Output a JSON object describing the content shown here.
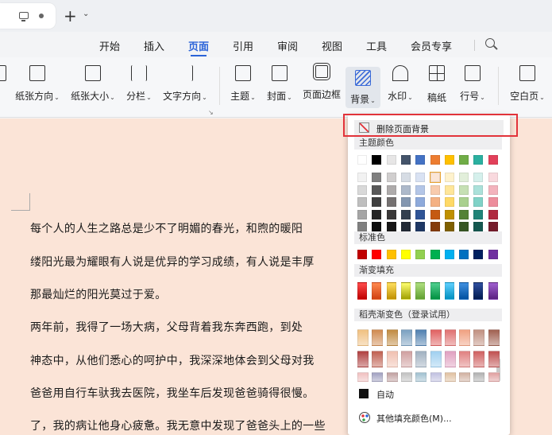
{
  "titlebar": {
    "new_tab": "+",
    "new_tab_chevron": "⌄"
  },
  "menu": [
    {
      "label": "开始",
      "active": false
    },
    {
      "label": "插入",
      "active": false
    },
    {
      "label": "页面",
      "active": true
    },
    {
      "label": "引用",
      "active": false
    },
    {
      "label": "审阅",
      "active": false
    },
    {
      "label": "视图",
      "active": false
    },
    {
      "label": "工具",
      "active": false
    },
    {
      "label": "会员专享",
      "active": false
    }
  ],
  "ribbon": {
    "orientation": "纸张方向",
    "size": "纸张大小",
    "columns": "分栏",
    "text_dir": "文字方向",
    "theme": "主题",
    "cover": "封面",
    "page_border": "页面边框",
    "background": "背景",
    "watermark": "水印",
    "draft": "稿纸",
    "line_num": "行号",
    "blank_page": "空白页",
    "chevron": "⌄",
    "launcher": "↘"
  },
  "document": {
    "lines": [
      "      每个人的人生之路总是少不了明媚的春光，和煦的暖阳",
      "缕阳光最为耀眼有人说是优异的学习成绩，有人说是丰厚",
      "那最灿烂的阳光莫过于爱。",
      "      两年前，我得了一场大病，父母背着我东奔西跑，到处",
      "神态中，从他们悉心的呵护中，我深深地体会到父母对我",
      "爸爸用自行车驮我去医院，我坐车后发现爸爸骑得很慢。",
      "了，我的病让他身心疲惫。我无意中发现了爸爸头上的一些"
    ]
  },
  "dropdown": {
    "remove_bg": "删除页面背景",
    "theme_colors": "主题颜色",
    "standard_colors": "标准色",
    "gradient_fill": "渐变填充",
    "docer_gradient": "稻壳渐变色（登录试用）",
    "auto": "自动",
    "more_colors": "其他填充颜色(M)..."
  },
  "colors": {
    "theme_row": [
      "#ffffff",
      "#000000",
      "#e7e6e6",
      "#44546a",
      "#4472c4",
      "#ed7d31",
      "#ffc000",
      "#70ad47",
      "#2bb0a0",
      "#e2405a"
    ],
    "theme_cols": [
      [
        "#f2f2f2",
        "#d9d9d9",
        "#bfbfbf",
        "#a6a6a6",
        "#808080"
      ],
      [
        "#7f7f7f",
        "#595959",
        "#404040",
        "#262626",
        "#0d0d0d"
      ],
      [
        "#d0cece",
        "#aeabab",
        "#757171",
        "#3a3838",
        "#171616"
      ],
      [
        "#d6dce4",
        "#adb9ca",
        "#8497b0",
        "#333f4f",
        "#222a35"
      ],
      [
        "#d9e2f3",
        "#b4c6e7",
        "#8eaadb",
        "#2f5496",
        "#1f3864"
      ],
      [
        "#fbe5d6",
        "#f8cbad",
        "#f4b183",
        "#c55a11",
        "#843c0c"
      ],
      [
        "#fff2cc",
        "#ffe699",
        "#ffd966",
        "#bf9000",
        "#7f6000"
      ],
      [
        "#e2efda",
        "#c6e0b4",
        "#a9d08e",
        "#548235",
        "#375623"
      ],
      [
        "#d5f0ec",
        "#abe1da",
        "#80d2c7",
        "#208478",
        "#155850"
      ],
      [
        "#f9d9de",
        "#f3b3bd",
        "#ed8d9c",
        "#b02a40",
        "#751c2b"
      ]
    ],
    "standard": [
      "#c00000",
      "#ff0000",
      "#ffc000",
      "#ffff00",
      "#92d050",
      "#00b050",
      "#00b0f0",
      "#0070c0",
      "#002060",
      "#7030a0"
    ],
    "gradient": [
      [
        "#c00000",
        "#ff4d4d"
      ],
      [
        "#d04010",
        "#ff8a50"
      ],
      [
        "#c09000",
        "#ffe060"
      ],
      [
        "#a0a000",
        "#ffff70"
      ],
      [
        "#60a030",
        "#b0e080"
      ],
      [
        "#009040",
        "#50d090"
      ],
      [
        "#0090c0",
        "#60d0ff"
      ],
      [
        "#0050a0",
        "#4090e0"
      ],
      [
        "#001a50",
        "#3050a0"
      ],
      [
        "#5a2080",
        "#a060d0"
      ]
    ],
    "docer_rows": [
      [
        "#f0c080",
        "#d08a50",
        "#c08a40",
        "#7aa0c0",
        "#5080b0",
        "#e06060",
        "#e07070",
        "#f0a080",
        "#c09080",
        "#a06050"
      ],
      [
        "#b04040",
        "#c06050",
        "#f0c0b0",
        "#d0a0a0",
        "#a0b0c0",
        "#a0d0f0",
        "#e0a0c0",
        "#e08080",
        "#d06060",
        "#c05050"
      ],
      [
        "#f0c0c0",
        "#a0a0c0",
        "#c0a0a0",
        "#c0c0c0",
        "#a0c0d0",
        "#c0c0e0",
        "#e0c0a0",
        "#d0b0a0",
        "#b0b0b0",
        "#e0a0a0"
      ]
    ]
  }
}
